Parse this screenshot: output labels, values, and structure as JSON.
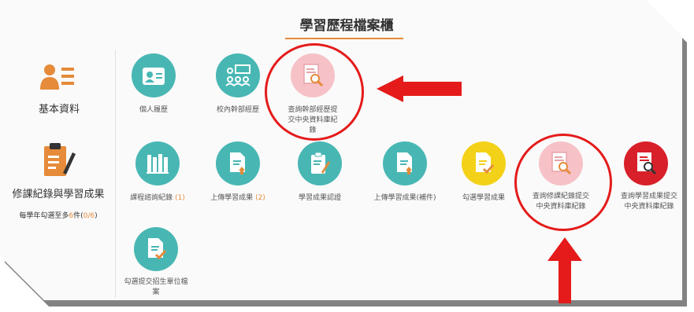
{
  "page": {
    "title": "學習歷程檔案櫃"
  },
  "sidebar": {
    "basic_label": "基本資料",
    "course_label": "修課紀錄與學習成果",
    "quota": {
      "prefix": "每學年勾選至多",
      "max": "6",
      "unit": "件(",
      "count": "0/6",
      "suffix": ")"
    }
  },
  "items": {
    "row1": [
      {
        "label": "個人履歷",
        "icon": "id-card-icon"
      },
      {
        "label": "校內幹部經歷",
        "icon": "group-icon"
      },
      {
        "label": "查詢幹部經歷提交中央資料庫紀錄",
        "icon": "document-search-icon"
      }
    ],
    "row2": [
      {
        "label": "課程諮詢紀錄",
        "count": "(1)",
        "icon": "books-icon"
      },
      {
        "label": "上傳學習成果",
        "count": "(2)",
        "icon": "upload-document-icon"
      },
      {
        "label": "學習成果認證",
        "icon": "clipboard-edit-icon"
      },
      {
        "label": "上傳學習成果(補件)",
        "icon": "upload-document-icon"
      },
      {
        "label": "勾選學習成果",
        "icon": "document-check-icon"
      },
      {
        "label": "查詢修課紀錄提交中央資料庫紀錄",
        "icon": "document-search-icon"
      },
      {
        "label": "查詢學習成果提交中央資料庫紀錄",
        "icon": "document-search-icon"
      }
    ],
    "row3": [
      {
        "label": "勾選提交招生單位檔案",
        "icon": "document-check-icon"
      }
    ]
  },
  "colors": {
    "teal": "#48b7b4",
    "pink": "#f6c2c7",
    "yellow": "#f3d118",
    "red": "#d8202a",
    "accent": "#e58b3a",
    "annotation": "#e51b1b"
  }
}
